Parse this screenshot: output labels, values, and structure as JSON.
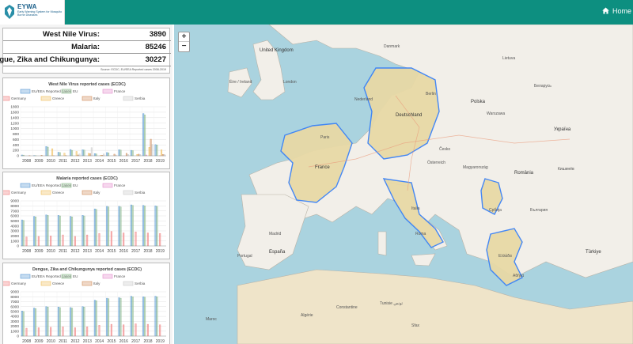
{
  "header": {
    "logo_title": "EYWA",
    "logo_subtitle": "Early Warning System for Mosquito Borne Diseases",
    "home_label": "Home",
    "bar_color": "#0d8f80"
  },
  "stats": [
    {
      "label": "West Nile Virus:",
      "value": "3890"
    },
    {
      "label": "Malaria:",
      "value": "85246"
    },
    {
      "label": "Dengue, Zika and Chikungunya:",
      "value": "30227"
    }
  ],
  "stats_source": "Source: ECDC, EU/EEA Reported cases 2008-2019",
  "chart_data": [
    {
      "type": "bar",
      "title": "West Nile Virus reported cases (ECDC)",
      "categories": [
        "2008",
        "2009",
        "2010",
        "2011",
        "2012",
        "2013",
        "2014",
        "2015",
        "2016",
        "2017",
        "2018",
        "2019"
      ],
      "ylim": [
        0,
        1800
      ],
      "yticks": [
        0,
        200,
        400,
        600,
        800,
        1000,
        1200,
        1400,
        1600,
        1800
      ],
      "series": [
        {
          "name": "EU/EEA Reported cases",
          "color": "#5b9bd5",
          "values": [
            30,
            10,
            340,
            130,
            230,
            220,
            80,
            120,
            220,
            200,
            1550,
            410
          ]
        },
        {
          "name": "EU",
          "color": "#8fbc8f",
          "values": [
            25,
            8,
            320,
            120,
            200,
            210,
            70,
            110,
            210,
            190,
            1500,
            400
          ]
        },
        {
          "name": "France",
          "color": "#e58fcf",
          "values": [
            0,
            0,
            0,
            0,
            0,
            0,
            0,
            0,
            0,
            0,
            30,
            0
          ]
        },
        {
          "name": "Germany",
          "color": "#f08080",
          "values": [
            0,
            0,
            0,
            0,
            0,
            0,
            0,
            0,
            0,
            0,
            0,
            5
          ]
        },
        {
          "name": "Greece",
          "color": "#f0c060",
          "values": [
            0,
            0,
            260,
            100,
            160,
            90,
            20,
            0,
            0,
            50,
            310,
            220
          ]
        },
        {
          "name": "Italy",
          "color": "#d2905f",
          "values": [
            10,
            20,
            5,
            10,
            30,
            80,
            20,
            60,
            90,
            60,
            610,
            50
          ]
        },
        {
          "name": "Serbia",
          "color": "#cccccc",
          "values": [
            0,
            0,
            0,
            0,
            70,
            300,
            70,
            30,
            50,
            50,
            420,
            50
          ]
        }
      ]
    },
    {
      "type": "bar",
      "title": "Malaria reported cases (ECDC)",
      "categories": [
        "2008",
        "2009",
        "2010",
        "2011",
        "2012",
        "2013",
        "2014",
        "2015",
        "2016",
        "2017",
        "2018",
        "2019"
      ],
      "ylim": [
        0,
        9000
      ],
      "yticks": [
        0,
        1000,
        2000,
        3000,
        4000,
        5000,
        6000,
        7000,
        8000,
        9000
      ],
      "series": [
        {
          "name": "EU/EEA Reported cases",
          "color": "#5b9bd5",
          "values": [
            5200,
            5900,
            6200,
            6100,
            5900,
            6100,
            7400,
            7900,
            7900,
            8200,
            8100,
            8000
          ]
        },
        {
          "name": "EU",
          "color": "#8fbc8f",
          "values": [
            5100,
            5800,
            6100,
            6000,
            5800,
            6000,
            7300,
            7800,
            7800,
            8100,
            8000,
            7900
          ]
        },
        {
          "name": "France",
          "color": "#e58fcf",
          "values": [
            0,
            0,
            0,
            0,
            0,
            0,
            0,
            0,
            0,
            0,
            0,
            0
          ]
        },
        {
          "name": "Germany",
          "color": "#f08080",
          "values": [
            1800,
            1900,
            2000,
            2200,
            1900,
            2200,
            2500,
            2900,
            2600,
            2800,
            2600,
            2500
          ]
        },
        {
          "name": "Greece",
          "color": "#f0c060",
          "values": [
            0,
            0,
            0,
            0,
            0,
            0,
            0,
            0,
            0,
            0,
            0,
            0
          ]
        },
        {
          "name": "Italy",
          "color": "#d2905f",
          "values": [
            0,
            0,
            0,
            0,
            0,
            0,
            0,
            0,
            0,
            0,
            0,
            0
          ]
        },
        {
          "name": "Serbia",
          "color": "#cccccc",
          "values": [
            0,
            0,
            0,
            0,
            0,
            0,
            0,
            0,
            0,
            0,
            0,
            0
          ]
        }
      ]
    },
    {
      "type": "bar",
      "title": "Dengue, Zika and Chikungunya reported cases (ECDC)",
      "categories": [
        "2008",
        "2009",
        "2010",
        "2011",
        "2012",
        "2013",
        "2014",
        "2015",
        "2016",
        "2017",
        "2018",
        "2019"
      ],
      "ylim": [
        0,
        9000
      ],
      "yticks": [
        0,
        1000,
        2000,
        3000,
        4000,
        5000,
        6000,
        7000,
        8000,
        9000
      ],
      "series": [
        {
          "name": "EU/EEA Reported cases",
          "color": "#5b9bd5",
          "values": [
            5100,
            5700,
            6000,
            5900,
            5800,
            6000,
            7300,
            7700,
            7800,
            8100,
            8000,
            8100
          ]
        },
        {
          "name": "EU",
          "color": "#8fbc8f",
          "values": [
            5000,
            5600,
            5900,
            5800,
            5700,
            5900,
            7200,
            7600,
            7700,
            8000,
            7900,
            8000
          ]
        },
        {
          "name": "France",
          "color": "#e58fcf",
          "values": [
            0,
            0,
            0,
            0,
            0,
            0,
            0,
            0,
            0,
            0,
            0,
            0
          ]
        },
        {
          "name": "Germany",
          "color": "#f08080",
          "values": [
            1600,
            1700,
            1800,
            1900,
            1700,
            1900,
            2200,
            2400,
            2300,
            2500,
            2400,
            2300
          ]
        },
        {
          "name": "Greece",
          "color": "#f0c060",
          "values": [
            0,
            0,
            0,
            0,
            0,
            0,
            0,
            0,
            0,
            0,
            0,
            0
          ]
        },
        {
          "name": "Italy",
          "color": "#d2905f",
          "values": [
            0,
            0,
            0,
            0,
            0,
            0,
            0,
            0,
            0,
            0,
            0,
            0
          ]
        },
        {
          "name": "Serbia",
          "color": "#cccccc",
          "values": [
            0,
            0,
            0,
            0,
            0,
            0,
            0,
            0,
            0,
            0,
            0,
            0
          ]
        }
      ]
    }
  ],
  "map": {
    "zoom_in": "+",
    "zoom_out": "−",
    "labels": [
      {
        "text": "United Kingdom",
        "cls": "big"
      },
      {
        "text": "Éire / Ireland",
        "cls": ""
      },
      {
        "text": "Deutschland",
        "cls": "big"
      },
      {
        "text": "France",
        "cls": "big"
      },
      {
        "text": "España",
        "cls": "big"
      },
      {
        "text": "Portugal",
        "cls": ""
      },
      {
        "text": "Italia",
        "cls": ""
      },
      {
        "text": "Polska",
        "cls": "big"
      },
      {
        "text": "Česko",
        "cls": ""
      },
      {
        "text": "Magyarország",
        "cls": ""
      },
      {
        "text": "România",
        "cls": "big"
      },
      {
        "text": "Україна",
        "cls": "big"
      },
      {
        "text": "Беларусь",
        "cls": ""
      },
      {
        "text": "Lietuva",
        "cls": ""
      },
      {
        "text": "Danmark",
        "cls": ""
      },
      {
        "text": "Nederland",
        "cls": ""
      },
      {
        "text": "Österreich",
        "cls": ""
      },
      {
        "text": "Србија",
        "cls": ""
      },
      {
        "text": "България",
        "cls": ""
      },
      {
        "text": "Türkiye",
        "cls": "big"
      },
      {
        "text": "Ελλάδα",
        "cls": ""
      },
      {
        "text": "Tunisie تونس",
        "cls": ""
      },
      {
        "text": "Algérie",
        "cls": ""
      },
      {
        "text": "Maroc",
        "cls": ""
      },
      {
        "text": "London",
        "cls": ""
      },
      {
        "text": "Paris",
        "cls": ""
      },
      {
        "text": "Madrid",
        "cls": ""
      },
      {
        "text": "Berlin",
        "cls": ""
      },
      {
        "text": "Roma",
        "cls": ""
      },
      {
        "text": "Warszawa",
        "cls": ""
      },
      {
        "text": "Кишинёв",
        "cls": ""
      },
      {
        "text": "Αθήνα",
        "cls": ""
      },
      {
        "text": "Constantine",
        "cls": ""
      },
      {
        "text": "Sfax",
        "cls": ""
      }
    ]
  }
}
